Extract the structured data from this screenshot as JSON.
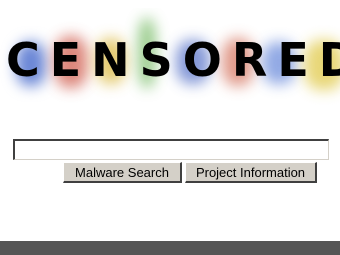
{
  "logo": {
    "overlay_text": "CENSORED",
    "blur_colors": [
      "#6b87d6",
      "#d46a5c",
      "#e0c25a",
      "#7fbf6e",
      "#6f86d0",
      "#d9826f",
      "#7f9be0",
      "#e6d36a"
    ]
  },
  "search": {
    "value": "",
    "placeholder": ""
  },
  "buttons": {
    "malware_search": "Malware Search",
    "project_information": "Project Information"
  },
  "colors": {
    "button_face": "#d4d0c8",
    "bottom_bar": "#555555"
  }
}
